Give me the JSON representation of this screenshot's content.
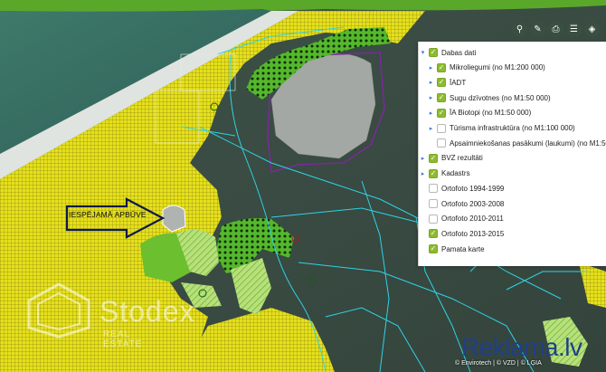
{
  "annotation": "IESPĒJAMĀ APBŪVE",
  "colors": {
    "yellow_zone": "#e6e01c",
    "green_biotope": "#6cbf2e",
    "light_green": "#b8e07a",
    "purple_boundary": "#7a2a9a",
    "cyan_parcels": "#2fd3e6",
    "header_green": "#5aa82a"
  },
  "toolbar": [
    {
      "icon": "location-pin-icon",
      "glyph": "⚲"
    },
    {
      "icon": "ruler-pencil-icon",
      "glyph": "✎"
    },
    {
      "icon": "print-icon",
      "glyph": "⎙"
    },
    {
      "icon": "list-icon",
      "glyph": "☰"
    },
    {
      "icon": "layers-icon",
      "glyph": "◈"
    }
  ],
  "layers": [
    {
      "label": "Dabas dati",
      "checked": true,
      "expanded": true,
      "level": 0
    },
    {
      "label": "Mikroliegumi (no M1:200 000)",
      "checked": true,
      "expanded": false,
      "level": 1
    },
    {
      "label": "ĪADT",
      "checked": true,
      "expanded": false,
      "level": 1
    },
    {
      "label": "Sugu dzīvotnes (no M1:50 000)",
      "checked": true,
      "expanded": false,
      "level": 1
    },
    {
      "label": "ĪA Biotopi (no M1:50 000)",
      "checked": true,
      "expanded": false,
      "level": 1
    },
    {
      "label": "Tūrisma infrastruktūra (no M1:100 000)",
      "checked": false,
      "expanded": false,
      "level": 1
    },
    {
      "label": "Apsaimniekošanas pasākumi (laukumi) (no M1:50",
      "checked": false,
      "expanded": null,
      "level": 1
    },
    {
      "label": "BVZ rezultāti",
      "checked": true,
      "expanded": false,
      "level": 0
    },
    {
      "label": "Kadastrs",
      "checked": true,
      "expanded": false,
      "level": 0
    },
    {
      "label": "Ortofoto 1994-1999",
      "checked": false,
      "expanded": null,
      "level": 0
    },
    {
      "label": "Ortofoto 2003-2008",
      "checked": false,
      "expanded": null,
      "level": 0
    },
    {
      "label": "Ortofoto 2010-2011",
      "checked": false,
      "expanded": null,
      "level": 0
    },
    {
      "label": "Ortofoto 2013-2015",
      "checked": true,
      "expanded": null,
      "level": 0
    },
    {
      "label": "Pamata karte",
      "checked": true,
      "expanded": null,
      "level": 0
    }
  ],
  "watermark": {
    "brand": "Stodex",
    "sub": "REAL ESTATE"
  },
  "reklama": {
    "name": "Reklama",
    "tld": ".lv"
  },
  "credits": "© Envirotech | © VZD | © LĢIA"
}
